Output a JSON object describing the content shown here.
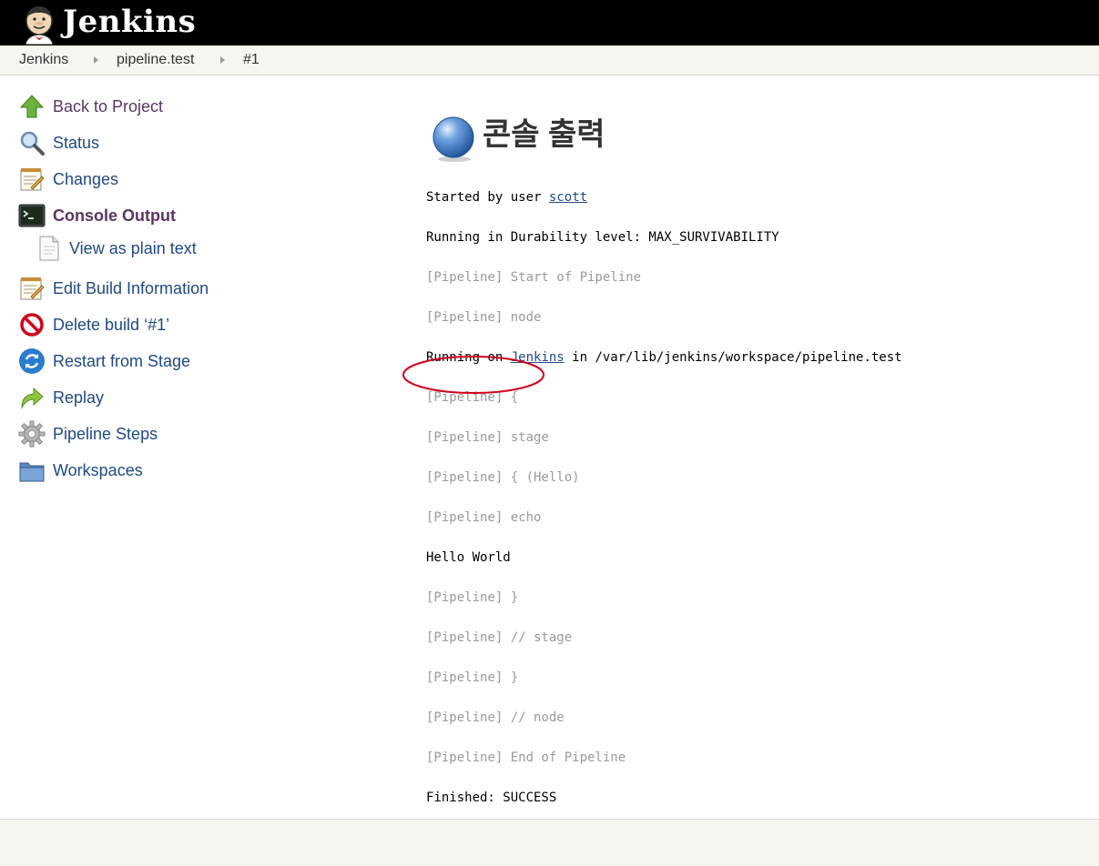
{
  "header": {
    "title": "Jenkins",
    "logo_icon": "jenkins-butler-icon"
  },
  "breadcrumb": [
    "Jenkins",
    "pipeline.test",
    "#1"
  ],
  "sidebar": {
    "items": [
      {
        "label": "Back to Project",
        "icon": "up-arrow-icon"
      },
      {
        "label": "Status",
        "icon": "search-icon"
      },
      {
        "label": "Changes",
        "icon": "notepad-icon"
      },
      {
        "label": "Console Output",
        "icon": "terminal-icon",
        "active": true
      },
      {
        "label": "View as plain text",
        "icon": "document-icon"
      },
      {
        "label": "Edit Build Information",
        "icon": "notepad-icon"
      },
      {
        "label": "Delete build ‘#1’",
        "icon": "no-entry-icon"
      },
      {
        "label": "Restart from Stage",
        "icon": "refresh-icon"
      },
      {
        "label": "Replay",
        "icon": "redo-arrow-icon"
      },
      {
        "label": "Pipeline Steps",
        "icon": "gear-icon"
      },
      {
        "label": "Workspaces",
        "icon": "folder-icon"
      }
    ]
  },
  "main": {
    "title": "콘솔 출력",
    "status_icon": "blue-ball-icon",
    "console": {
      "started_prefix": "Started by user ",
      "started_user": "scott",
      "durability": "Running in Durability level: MAX_SURVIVABILITY",
      "start_pipeline": "[Pipeline] Start of Pipeline",
      "node": "[Pipeline] node",
      "running_on_prefix": "Running on ",
      "running_on_node": "Jenkins",
      "running_on_suffix": " in /var/lib/jenkins/workspace/pipeline.test",
      "open_brace1": "[Pipeline] {",
      "stage": "[Pipeline] stage",
      "open_hello": "[Pipeline] { (Hello)",
      "echo": "[Pipeline] echo",
      "hello_world": "Hello World",
      "close_brace1": "[Pipeline] }",
      "end_stage": "[Pipeline] // stage",
      "close_brace2": "[Pipeline] }",
      "end_node": "[Pipeline] // node",
      "end_pipeline": "[Pipeline] End of Pipeline",
      "finished": "Finished: SUCCESS"
    }
  },
  "colors": {
    "link": "#204a87",
    "active": "#5c3566",
    "annotation": "#d0021b",
    "dim": "#9a9a9a"
  }
}
